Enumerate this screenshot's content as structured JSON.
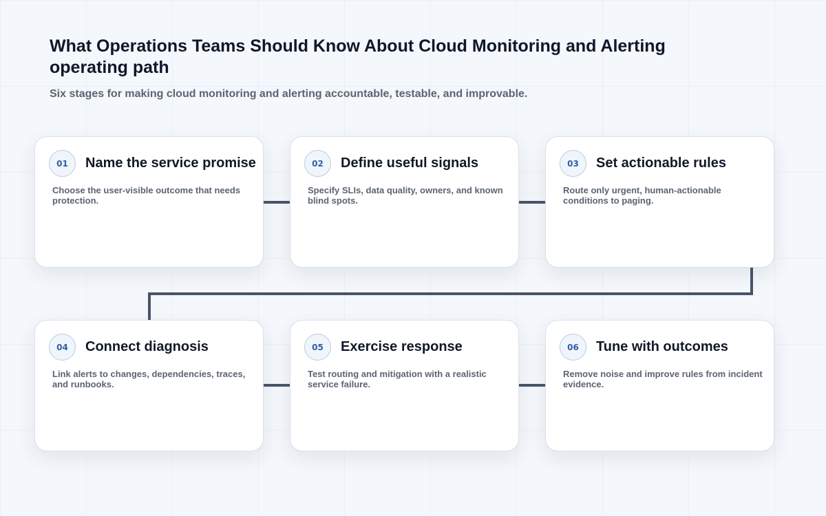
{
  "header": {
    "title": "What Operations Teams Should Know About Cloud Monitoring and Alerting operating path",
    "subtitle": "Six stages for making cloud monitoring and alerting accountable, testable, and improvable."
  },
  "stages": [
    {
      "number": "01",
      "title": "Name the service promise",
      "description": "Choose the user-visible outcome that needs protection."
    },
    {
      "number": "02",
      "title": "Define useful signals",
      "description": "Specify SLIs, data quality, owners, and known blind spots."
    },
    {
      "number": "03",
      "title": "Set actionable rules",
      "description": "Route only urgent, human-actionable conditions to paging."
    },
    {
      "number": "04",
      "title": "Connect diagnosis",
      "description": "Link alerts to changes, dependencies, traces, and runbooks."
    },
    {
      "number": "05",
      "title": "Exercise response",
      "description": "Test routing and mitigation with a realistic service failure."
    },
    {
      "number": "06",
      "title": "Tune with outcomes",
      "description": "Remove noise and improve rules from incident evidence."
    }
  ],
  "colors": {
    "connector": "#475569",
    "badge_text": "#2f5fa5",
    "badge_border": "#b8cbe6",
    "title": "#0f172a",
    "muted": "#5b6472"
  }
}
